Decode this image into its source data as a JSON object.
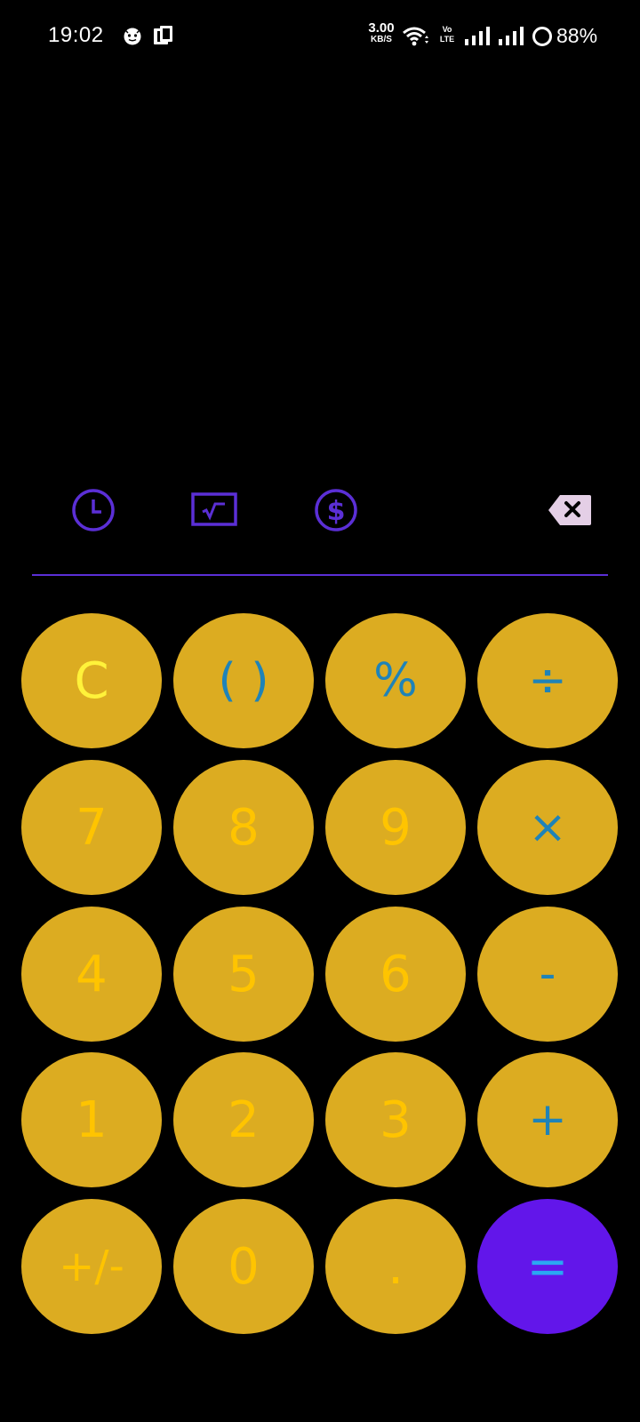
{
  "status_bar": {
    "time": "19:02",
    "net_speed_value": "3.00",
    "net_speed_unit": "KB/S",
    "volte_top": "Vo",
    "volte_bottom": "LTE",
    "battery": "88%"
  },
  "toolbar": {
    "history_icon": "clock-icon",
    "scientific_icon": "square-root-icon",
    "currency_icon": "dollar-icon",
    "backspace_icon": "backspace-icon"
  },
  "colors": {
    "key_background": "#dcac21",
    "digit_text": "#ffc400",
    "operator_text": "#1f83b8",
    "clear_text": "#fff23a",
    "equals_background": "#6216ea",
    "equals_text": "#2aa7f2",
    "accent_purple": "#5b2fd6",
    "backspace_background": "#e4cfe6"
  },
  "keypad": {
    "clear": "C",
    "parentheses": "( )",
    "percent": "%",
    "divide": "÷",
    "seven": "7",
    "eight": "8",
    "nine": "9",
    "multiply": "×",
    "four": "4",
    "five": "5",
    "six": "6",
    "minus": "-",
    "one": "1",
    "two": "2",
    "three": "3",
    "plus": "+",
    "plus_minus": "+/-",
    "zero": "0",
    "decimal": ".",
    "equals": "="
  }
}
